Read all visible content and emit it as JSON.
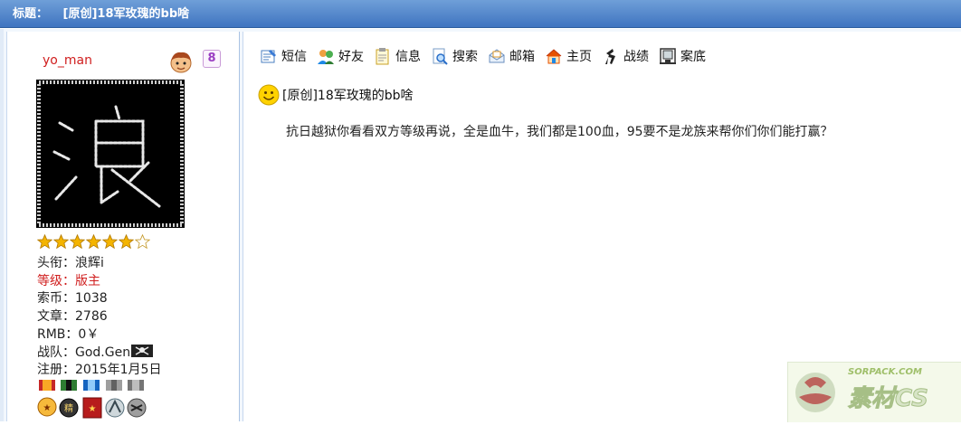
{
  "header": {
    "label": "标题：",
    "title": "[原创]18军玫瑰的bb啥"
  },
  "user": {
    "name": "yo_man",
    "gender_symbol": "8",
    "stars": 7,
    "stars_filled": 6,
    "stats": {
      "title": "头衔：浪辉i",
      "level": "等级：版主",
      "coins": "索币：1038",
      "articles": "文章：2786",
      "rmb": "RMB：0￥",
      "team": "战队：God.Gen",
      "registered": "注册：2015年1月5日"
    },
    "avatar_char": "浪",
    "medal_label": "精"
  },
  "toolbar": [
    {
      "label": "短信",
      "icon": "message-icon"
    },
    {
      "label": "好友",
      "icon": "friends-icon"
    },
    {
      "label": "信息",
      "icon": "info-icon"
    },
    {
      "label": "搜索",
      "icon": "search-icon"
    },
    {
      "label": "邮箱",
      "icon": "mail-icon"
    },
    {
      "label": "主页",
      "icon": "home-icon"
    },
    {
      "label": "战绩",
      "icon": "record-icon"
    },
    {
      "label": "案底",
      "icon": "case-file-icon"
    }
  ],
  "post": {
    "title": "[原创]18军玫瑰的bb啥",
    "body": "抗日越狱你看看双方等级再说，全是血牛，我们都是100血，95要不是龙族来帮你们你们能打赢？"
  },
  "watermark": {
    "url": "SORPACK.COM",
    "brand": "素材CS"
  }
}
